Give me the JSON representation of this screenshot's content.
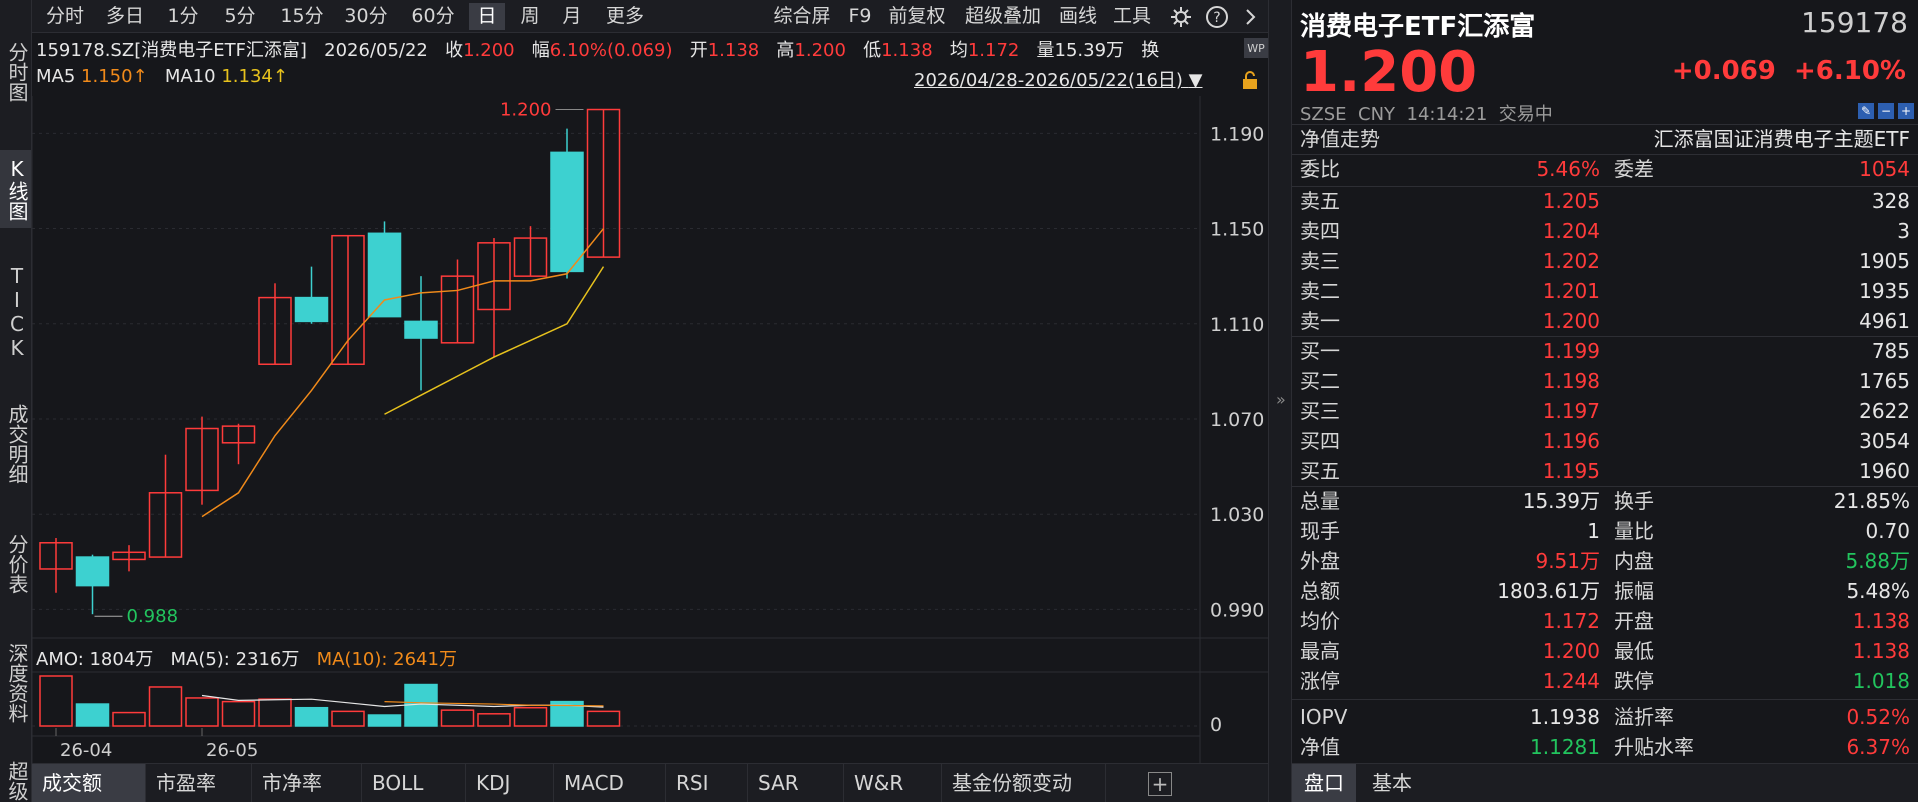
{
  "leftnav": [
    {
      "label": "分时图",
      "active": false
    },
    {
      "label": "K线图",
      "active": true
    },
    {
      "label": "TICK",
      "active": false
    },
    {
      "label": "成交明细",
      "active": false
    },
    {
      "label": "分价表",
      "active": false
    },
    {
      "label": "深度资料",
      "active": false
    },
    {
      "label": "超级",
      "active": false
    }
  ],
  "toolbar": {
    "periods": [
      "分时",
      "多日",
      "1分",
      "5分",
      "15分",
      "30分",
      "60分",
      "日",
      "周",
      "月",
      "更多"
    ],
    "active_period": "日",
    "tools": [
      "综合屏",
      "F9",
      "前复权",
      "超级叠加",
      "画线",
      "工具"
    ],
    "settings_icon": "gear-icon",
    "help_icon": "help-icon",
    "collapse_icon": "chevron-right-icon"
  },
  "quote_line": {
    "symbol": "159178.SZ[消费电子ETF汇添富]",
    "date": "2026/05/22",
    "close_label": "收",
    "close": "1.200",
    "range_label": "幅",
    "range": "6.10%(0.069)",
    "open_label": "开",
    "open": "1.138",
    "high_label": "高",
    "high": "1.200",
    "low_label": "低",
    "low": "1.138",
    "avg_label": "均",
    "avg": "1.172",
    "vol_label": "量",
    "vol": "15.39万",
    "turnover_label": "换"
  },
  "ma_line": {
    "ma5_label": "MA5",
    "ma5": "1.150↑",
    "ma10_label": "MA10",
    "ma10": "1.134↑",
    "date_range": "2026/04/28-2026/05/22(16日)"
  },
  "amo_line": {
    "amo": "AMO: 1804万",
    "ma5": "MA(5): 2316万",
    "ma10": "MA(10): 2641万"
  },
  "chart_data": {
    "type": "candlestick",
    "y_ticks": [
      "1.190",
      "1.150",
      "1.110",
      "1.070",
      "1.030",
      "0.990"
    ],
    "ylim": [
      0.978,
      1.204
    ],
    "x_tick_labels": [
      "26-04",
      "26-05"
    ],
    "max_label": "1.200",
    "min_label": "0.988",
    "volume_zero_label": "0",
    "candles": [
      {
        "o": 1.007,
        "c": 1.018,
        "h": 1.02,
        "l": 0.997
      },
      {
        "o": 1.012,
        "c": 1.0,
        "h": 1.013,
        "l": 0.988
      },
      {
        "o": 1.011,
        "c": 1.014,
        "h": 1.017,
        "l": 1.006
      },
      {
        "o": 1.012,
        "c": 1.039,
        "h": 1.055,
        "l": 1.012
      },
      {
        "o": 1.04,
        "c": 1.066,
        "h": 1.071,
        "l": 1.034
      },
      {
        "o": 1.06,
        "c": 1.067,
        "h": 1.068,
        "l": 1.051
      },
      {
        "o": 1.093,
        "c": 1.121,
        "h": 1.127,
        "l": 1.093
      },
      {
        "o": 1.121,
        "c": 1.111,
        "h": 1.134,
        "l": 1.11
      },
      {
        "o": 1.093,
        "c": 1.147,
        "h": 1.147,
        "l": 1.093
      },
      {
        "o": 1.148,
        "c": 1.113,
        "h": 1.153,
        "l": 1.113
      },
      {
        "o": 1.111,
        "c": 1.104,
        "h": 1.13,
        "l": 1.082
      },
      {
        "o": 1.102,
        "c": 1.13,
        "h": 1.137,
        "l": 1.102
      },
      {
        "o": 1.116,
        "c": 1.144,
        "h": 1.146,
        "l": 1.096
      },
      {
        "o": 1.13,
        "c": 1.146,
        "h": 1.151,
        "l": 1.13
      },
      {
        "o": 1.182,
        "c": 1.132,
        "h": 1.192,
        "l": 1.129
      },
      {
        "o": 1.138,
        "c": 1.2,
        "h": 1.2,
        "l": 1.138
      }
    ],
    "ma5": [
      null,
      null,
      null,
      null,
      1.029,
      1.039,
      1.063,
      1.082,
      1.103,
      1.12,
      1.123,
      1.124,
      1.128,
      1.128,
      1.131,
      1.15
    ],
    "ma10": [
      null,
      null,
      null,
      null,
      null,
      null,
      null,
      null,
      null,
      1.072,
      1.08,
      1.088,
      1.096,
      1.103,
      1.11,
      1.134
    ],
    "volume_wan": [
      4100,
      1800,
      1100,
      3200,
      2300,
      2000,
      2200,
      1500,
      1200,
      900,
      3400,
      1300,
      1000,
      1500,
      2000,
      1200
    ],
    "volume_ma5": [
      null,
      null,
      null,
      null,
      2500,
      2100,
      2150,
      2200,
      1900,
      1600,
      1800,
      1700,
      1600,
      1700,
      1700,
      1550
    ],
    "volume_ma10": [
      null,
      null,
      null,
      null,
      null,
      null,
      null,
      null,
      null,
      2000,
      1900,
      1850,
      1800,
      1700,
      1680,
      1650
    ]
  },
  "bottom_tabs": [
    "成交额",
    "市盈率",
    "市净率",
    "BOLL",
    "KDJ",
    "MACD",
    "RSI",
    "SAR",
    "W&R",
    "基金份额变动"
  ],
  "bottom_active": "成交额",
  "right": {
    "name": "消费电子ETF汇添富",
    "code": "159178",
    "price": "1.200",
    "change": "+0.069",
    "change_pct": "+6.10%",
    "market": "SZSE",
    "currency": "CNY",
    "time": "14:14:21",
    "status": "交易中",
    "nav_trend_label": "净值走势",
    "fund_fullname": "汇添富国证消费电子主题ETF",
    "weibi_label": "委比",
    "weibi": "5.46%",
    "weicha_label": "委差",
    "weicha": "1054",
    "asks": [
      {
        "label": "卖五",
        "price": "1.205",
        "vol": "328"
      },
      {
        "label": "卖四",
        "price": "1.204",
        "vol": "3"
      },
      {
        "label": "卖三",
        "price": "1.202",
        "vol": "1905"
      },
      {
        "label": "卖二",
        "price": "1.201",
        "vol": "1935"
      },
      {
        "label": "卖一",
        "price": "1.200",
        "vol": "4961"
      }
    ],
    "bids": [
      {
        "label": "买一",
        "price": "1.199",
        "vol": "785"
      },
      {
        "label": "买二",
        "price": "1.198",
        "vol": "1765"
      },
      {
        "label": "买三",
        "price": "1.197",
        "vol": "2622"
      },
      {
        "label": "买四",
        "price": "1.196",
        "vol": "3054"
      },
      {
        "label": "买五",
        "price": "1.195",
        "vol": "1960"
      }
    ],
    "stats": [
      {
        "l1": "总量",
        "v1": "15.39万",
        "c1": "white",
        "l2": "换手",
        "v2": "21.85%",
        "c2": "white"
      },
      {
        "l1": "现手",
        "v1": "1",
        "c1": "white",
        "l2": "量比",
        "v2": "0.70",
        "c2": "white"
      },
      {
        "l1": "外盘",
        "v1": "9.51万",
        "c1": "red",
        "l2": "内盘",
        "v2": "5.88万",
        "c2": "green"
      },
      {
        "l1": "总额",
        "v1": "1803.61万",
        "c1": "white",
        "l2": "振幅",
        "v2": "5.48%",
        "c2": "white"
      },
      {
        "l1": "均价",
        "v1": "1.172",
        "c1": "red",
        "l2": "开盘",
        "v2": "1.138",
        "c2": "red"
      },
      {
        "l1": "最高",
        "v1": "1.200",
        "c1": "red",
        "l2": "最低",
        "v2": "1.138",
        "c2": "red"
      },
      {
        "l1": "涨停",
        "v1": "1.244",
        "c1": "red",
        "l2": "跌停",
        "v2": "1.018",
        "c2": "green"
      },
      {
        "l1": "IOPV",
        "v1": "1.1938",
        "c1": "white",
        "l2": "溢折率",
        "v2": "0.52%",
        "c2": "red"
      },
      {
        "l1": "净值",
        "v1": "1.1281",
        "c1": "green",
        "l2": "升贴水率",
        "v2": "6.37%",
        "c2": "red"
      }
    ],
    "bottom_tabs": [
      "盘口",
      "基本"
    ],
    "bottom_active": "盘口"
  },
  "colors": {
    "up": "#ff3b3b",
    "down": "#3dd1d0",
    "ma5": "#f08a1a",
    "ma10": "#e7c21d",
    "bg": "#16171b"
  }
}
